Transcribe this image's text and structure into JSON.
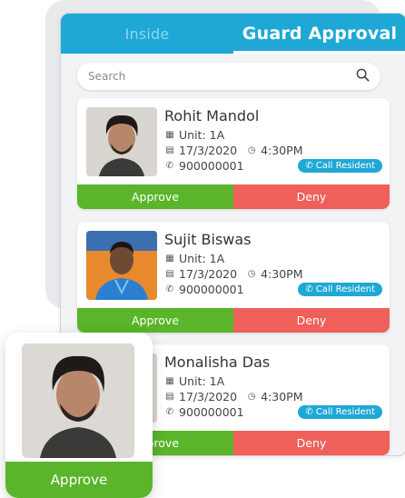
{
  "tabs": [
    {
      "label": "Inside",
      "active": false
    },
    {
      "label": "Guard Approval",
      "active": true
    }
  ],
  "search": {
    "placeholder": "Search"
  },
  "visitors": [
    {
      "name": "Rohit Mandol",
      "unit": "Unit: 1A",
      "date": "17/3/2020",
      "time": "4:30PM",
      "phone": "900000001",
      "call_label": "Call Resident",
      "approve_label": "Approve",
      "deny_label": "Deny"
    },
    {
      "name": "Sujit Biswas",
      "unit": "Unit: 1A",
      "date": "17/3/2020",
      "time": "4:30PM",
      "phone": "900000001",
      "call_label": "Call Resident",
      "approve_label": "Approve",
      "deny_label": "Deny"
    },
    {
      "name": "Monalisha Das",
      "unit": "Unit: 1A",
      "date": "17/3/2020",
      "time": "4:30PM",
      "phone": "900000001",
      "call_label": "Call Resident",
      "approve_label": "Approve",
      "deny_label": "Deny"
    }
  ],
  "popup": {
    "approve_label": "Approve"
  },
  "colors": {
    "header": "#1fa8d6",
    "approve": "#5ab52a",
    "deny": "#f0605a",
    "call_button": "#1fa8d6"
  }
}
